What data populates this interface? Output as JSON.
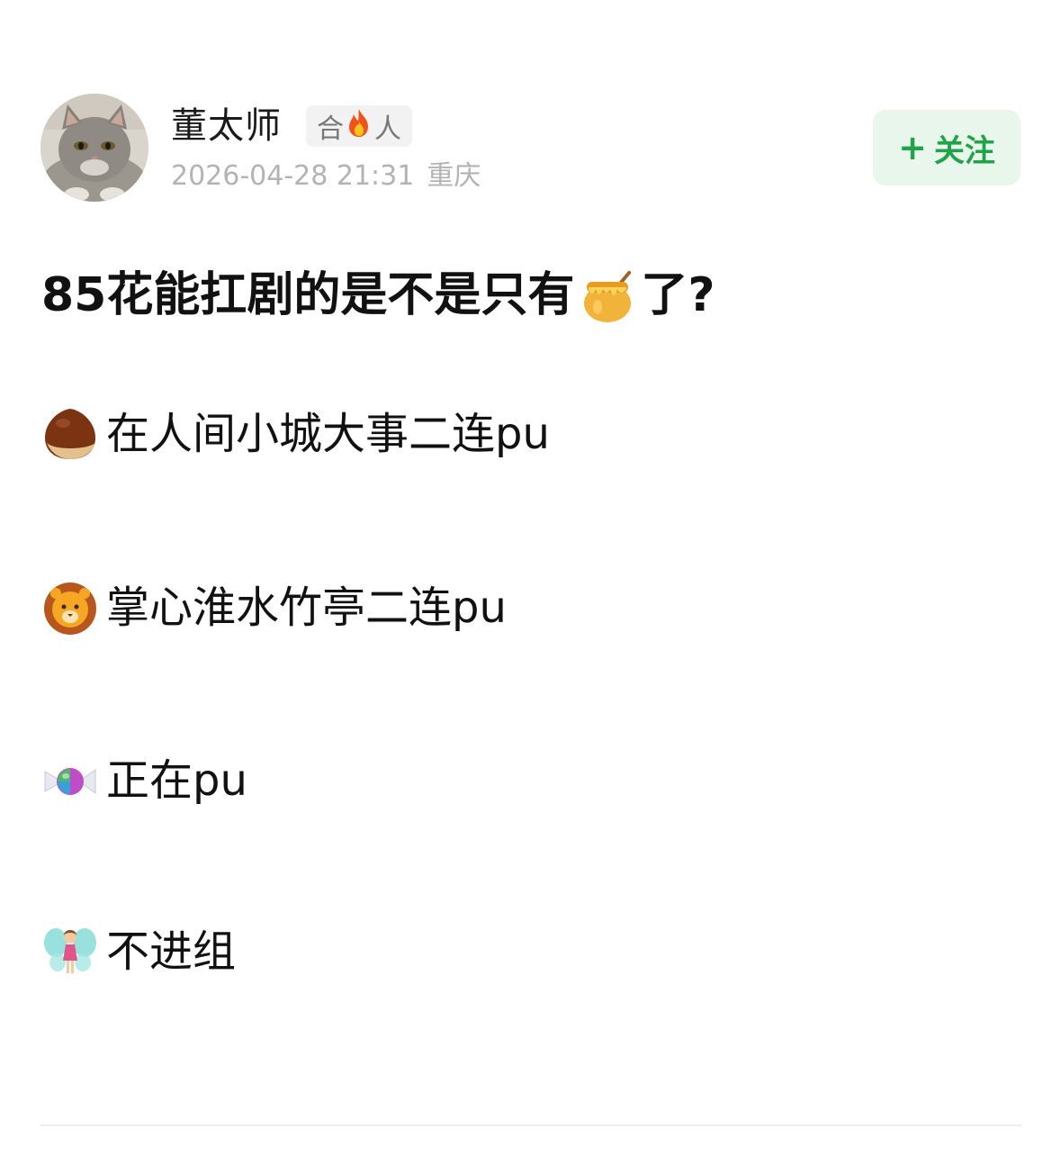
{
  "author": {
    "name": "董太师",
    "badge": {
      "prefix": "合",
      "icon": "fire-icon",
      "suffix": "人"
    },
    "timestamp": "2026-04-28 21:31",
    "location": "重庆"
  },
  "follow_button": {
    "plus": "+",
    "label": "关注",
    "color": "#21a34a",
    "background": "#e8f6ec"
  },
  "post": {
    "title_before": "85花能扛剧的是不是只有",
    "title_emoji": "honey-pot-icon",
    "title_after": "了?",
    "lines": [
      {
        "emoji": "chestnut-icon",
        "text": "在人间小城大事二连pu"
      },
      {
        "emoji": "lion-icon",
        "text": "掌心淮水竹亭二连pu"
      },
      {
        "emoji": "candy-icon",
        "text": "正在pu"
      },
      {
        "emoji": "fairy-icon",
        "text": "不进组"
      }
    ]
  }
}
